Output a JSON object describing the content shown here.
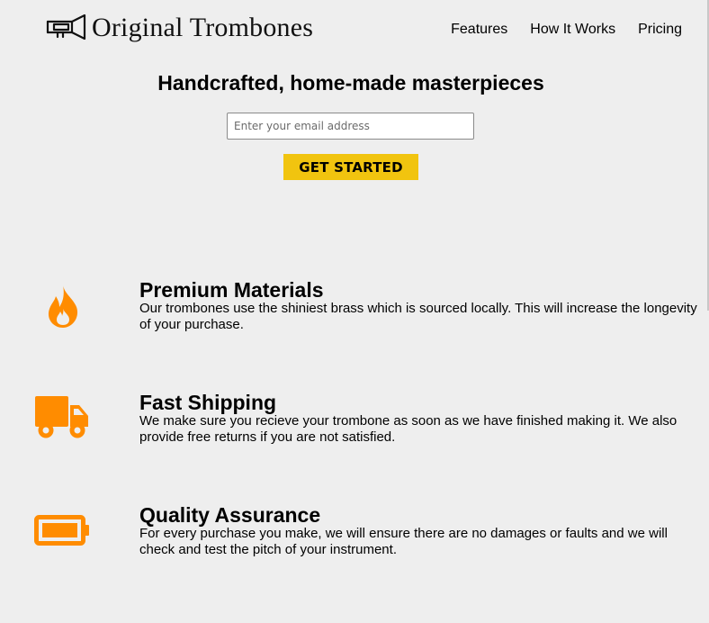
{
  "header": {
    "brand": "Original Trombones",
    "logo_icon": "trombone-icon",
    "nav": [
      {
        "label": "Features"
      },
      {
        "label": "How It Works"
      },
      {
        "label": "Pricing"
      }
    ]
  },
  "hero": {
    "title": "Handcrafted, home-made masterpieces",
    "email_placeholder": "Enter your email address",
    "cta_label": "GET STARTED"
  },
  "features": [
    {
      "icon": "fire-icon",
      "title": "Premium Materials",
      "description": "Our trombones use the shiniest brass which is sourced locally. This will increase the longevity of your purchase."
    },
    {
      "icon": "truck-icon",
      "title": "Fast Shipping",
      "description": "We make sure you recieve your trombone as soon as we have finished making it. We also provide free returns if you are not satisfied."
    },
    {
      "icon": "battery-icon",
      "title": "Quality Assurance",
      "description": "For every purchase you make, we will ensure there are no damages or faults and we will check and test the pitch of your instrument."
    }
  ],
  "colors": {
    "background": "#eeeeee",
    "accent_button": "#f1c40f",
    "icon_orange": "#ff8c00"
  }
}
